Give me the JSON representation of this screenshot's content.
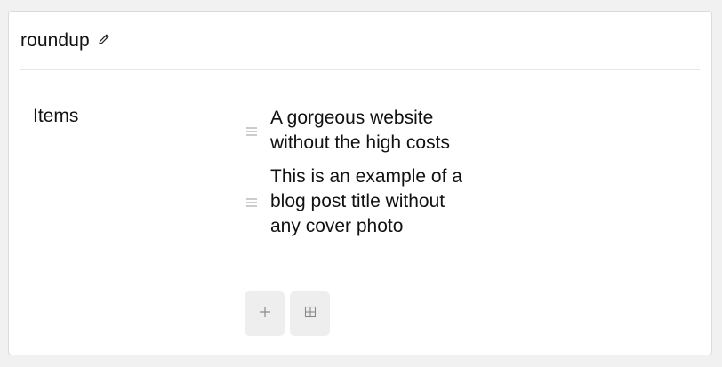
{
  "block": {
    "title": "roundup",
    "edit_icon": "pencil-icon"
  },
  "field": {
    "label": "Items"
  },
  "items": [
    {
      "text": "A gorgeous website without the high costs",
      "handle_icon": "drag-handle-icon"
    },
    {
      "text": "This is an example of a blog post title without any cover photo",
      "handle_icon": "drag-handle-icon"
    }
  ],
  "actions": [
    {
      "icon": "plus-icon"
    },
    {
      "icon": "grid-icon"
    }
  ],
  "colors": {
    "background": "#f1f1f1",
    "card": "#ffffff",
    "button_bg": "#eeeeee",
    "icon": "#8a8a8a"
  }
}
